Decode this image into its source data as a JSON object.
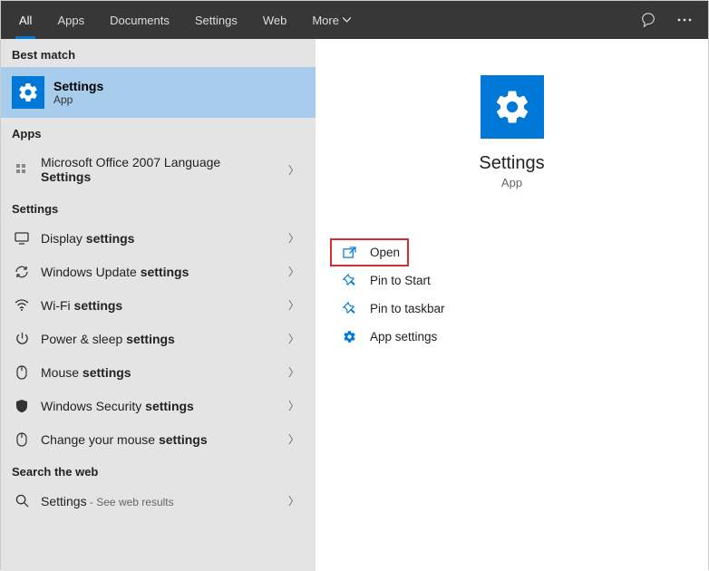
{
  "topbar": {
    "tabs": [
      "All",
      "Apps",
      "Documents",
      "Settings",
      "Web",
      "More"
    ],
    "activeIndex": 0
  },
  "left": {
    "bestMatchHeader": "Best match",
    "bestMatch": {
      "title": "Settings",
      "subtitle": "App"
    },
    "appsHeader": "Apps",
    "appItem": {
      "prefix": "Microsoft Office 2007 Language ",
      "bold": "Settings"
    },
    "settingsHeader": "Settings",
    "settingsItems": [
      {
        "prefix": "Display ",
        "bold": "settings",
        "icon": "display"
      },
      {
        "prefix": "Windows Update ",
        "bold": "settings",
        "icon": "refresh"
      },
      {
        "prefix": "Wi-Fi ",
        "bold": "settings",
        "icon": "wifi"
      },
      {
        "prefix": "Power & sleep ",
        "bold": "settings",
        "icon": "power"
      },
      {
        "prefix": "Mouse ",
        "bold": "settings",
        "icon": "mouse"
      },
      {
        "prefix": "Windows Security ",
        "bold": "settings",
        "icon": "shield"
      },
      {
        "prefix": "Change your mouse ",
        "bold": "settings",
        "icon": "mouse"
      }
    ],
    "webHeader": "Search the web",
    "webItem": {
      "query": "Settings",
      "suffix": " - See web results"
    }
  },
  "right": {
    "title": "Settings",
    "subtitle": "App",
    "actions": [
      {
        "label": "Open",
        "icon": "open",
        "highlighted": true
      },
      {
        "label": "Pin to Start",
        "icon": "pin"
      },
      {
        "label": "Pin to taskbar",
        "icon": "pin-taskbar"
      },
      {
        "label": "App settings",
        "icon": "gear"
      }
    ]
  }
}
